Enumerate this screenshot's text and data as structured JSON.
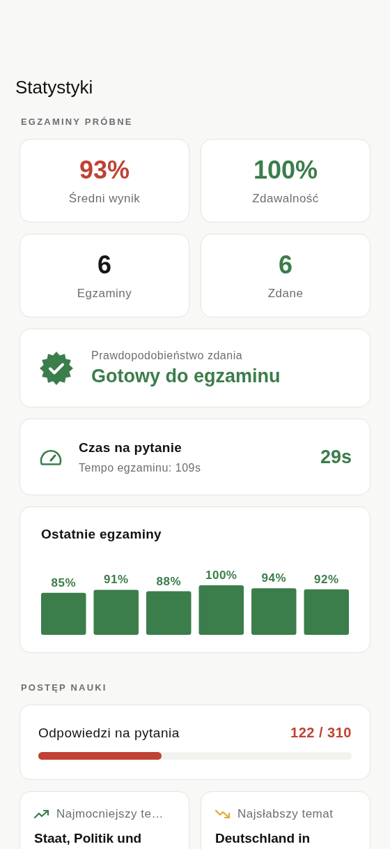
{
  "title": "Statystyki",
  "exam_section": {
    "label": "EGZAMINY PRÓBNE",
    "stats": [
      {
        "value": "93%",
        "label": "Średni wynik",
        "color": "#bf4233"
      },
      {
        "value": "100%",
        "label": "Zdawalność",
        "color": "#3b7d4b"
      },
      {
        "value": "6",
        "label": "Egzaminy",
        "color": "#161616"
      },
      {
        "value": "6",
        "label": "Zdane",
        "color": "#3b7d4b"
      }
    ],
    "readiness": {
      "label": "Prawdopodobieństwo zdania",
      "status": "Gotowy do egzaminu"
    },
    "pace": {
      "title": "Czas na pytanie",
      "subtitle": "Tempo egzaminu: 109s",
      "value": "29s"
    },
    "recent": {
      "title": "Ostatnie egzaminy",
      "bars": [
        {
          "value": "85%"
        },
        {
          "value": "91%"
        },
        {
          "value": "88%"
        },
        {
          "value": "100%"
        },
        {
          "value": "94%"
        },
        {
          "value": "92%"
        }
      ]
    }
  },
  "progress_section": {
    "label": "POSTĘP NAUKI",
    "answered": {
      "title": "Odpowiedzi na pytania",
      "count": "122 / 310",
      "level": 0.394
    },
    "topics": [
      {
        "kind": "strongest",
        "label": "Najmocniejszy te…",
        "topic": "Staat, Politik und"
      },
      {
        "kind": "weakest",
        "label": "Najsłabszy temat",
        "topic": "Deutschland in"
      }
    ]
  }
}
